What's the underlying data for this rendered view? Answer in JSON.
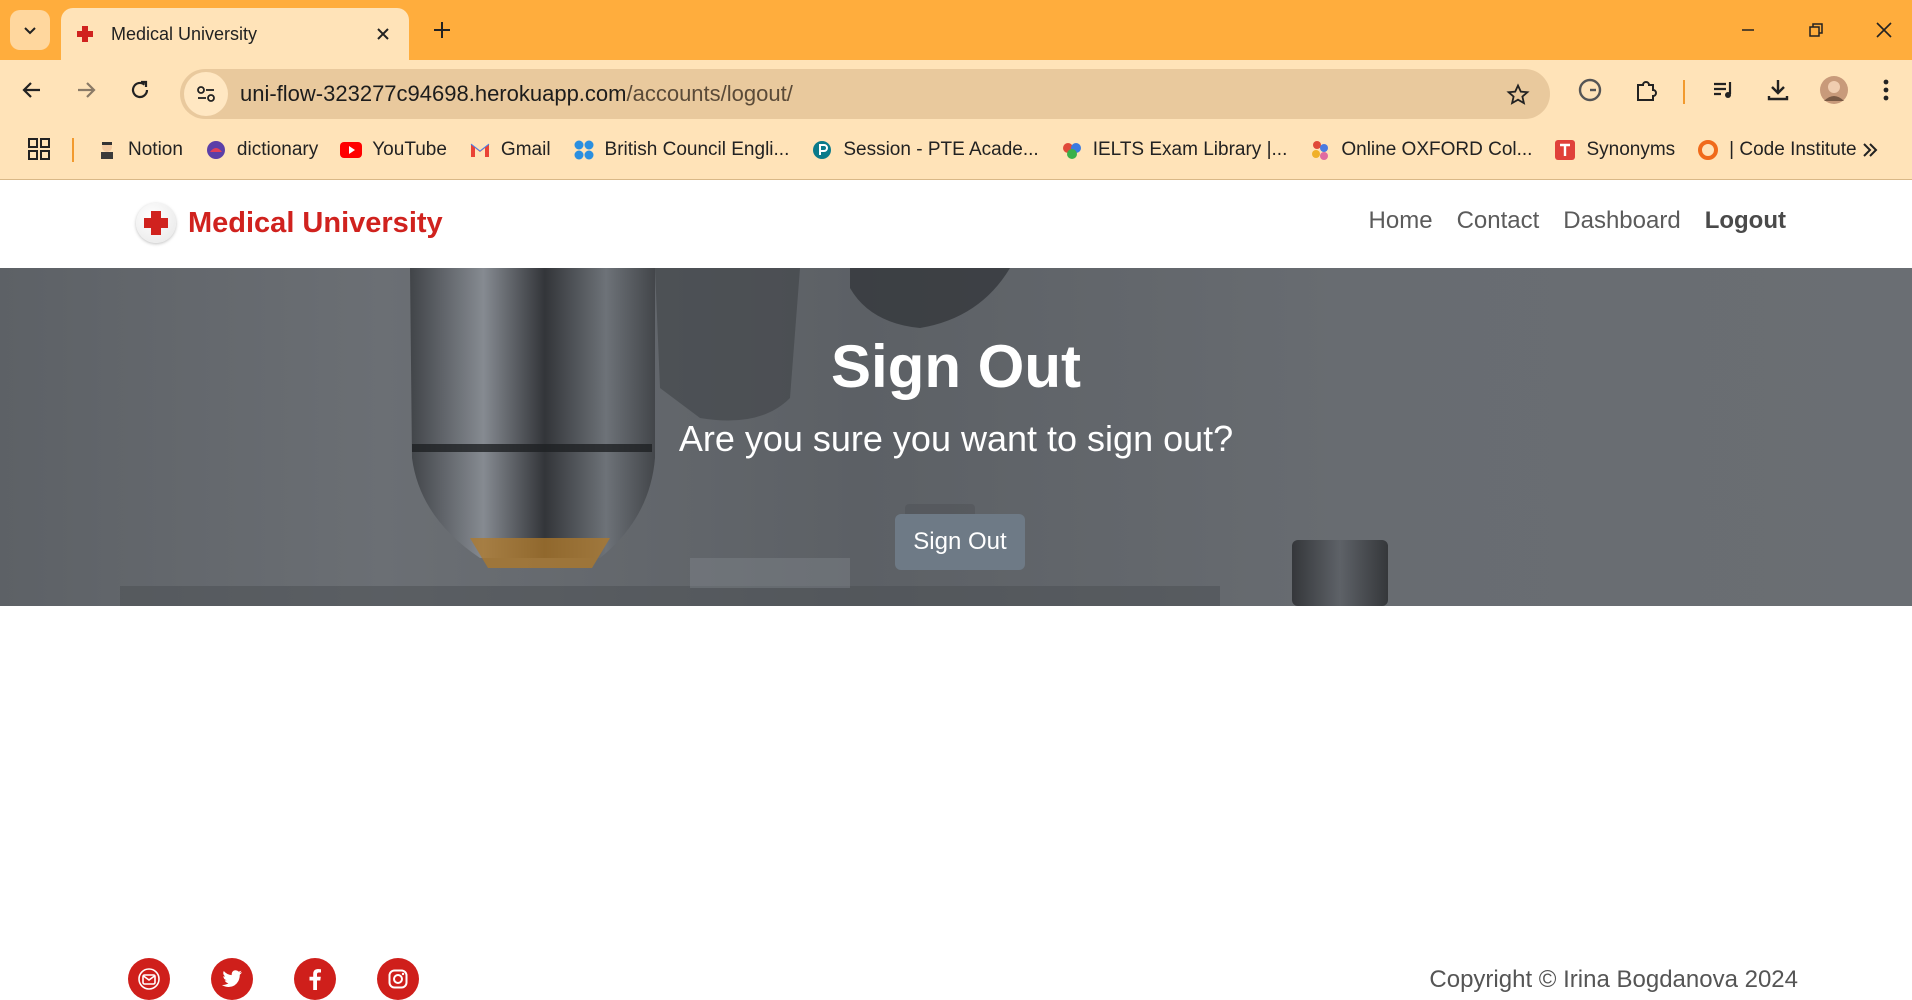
{
  "browser": {
    "tab_title": "Medical University",
    "url_host": "uni-flow-323277c94698.herokuapp.com",
    "url_path": "/accounts/logout/",
    "bookmarks": [
      {
        "label": "Notion",
        "icon": "notion-icon"
      },
      {
        "label": "dictionary",
        "icon": "dictionary-icon"
      },
      {
        "label": "YouTube",
        "icon": "youtube-icon"
      },
      {
        "label": "Gmail",
        "icon": "gmail-icon"
      },
      {
        "label": "British Council Engli...",
        "icon": "british-council-icon"
      },
      {
        "label": "Session - PTE Acade...",
        "icon": "pte-icon"
      },
      {
        "label": "IELTS Exam Library |...",
        "icon": "ielts-icon"
      },
      {
        "label": "Online OXFORD Col...",
        "icon": "oxford-icon"
      },
      {
        "label": "Synonyms",
        "icon": "synonyms-icon"
      },
      {
        "label": "| Code Institute",
        "icon": "code-institute-icon"
      }
    ],
    "colors": {
      "tabstrip": "#ffad3d",
      "toolbar": "#ffe3b8"
    }
  },
  "site": {
    "brand": "Medical University",
    "nav": {
      "home": "Home",
      "contact": "Contact",
      "dashboard": "Dashboard",
      "logout": "Logout"
    },
    "hero": {
      "title": "Sign Out",
      "subtitle": "Are you sure you want to sign out?",
      "button": "Sign Out"
    },
    "footer": {
      "social_icons": [
        "email-icon",
        "twitter-icon",
        "facebook-icon",
        "instagram-icon"
      ],
      "copyright": "Copyright © Irina Bogdanova 2024"
    },
    "colors": {
      "brand_red": "#d0221e",
      "button": "#6e7a86"
    }
  }
}
